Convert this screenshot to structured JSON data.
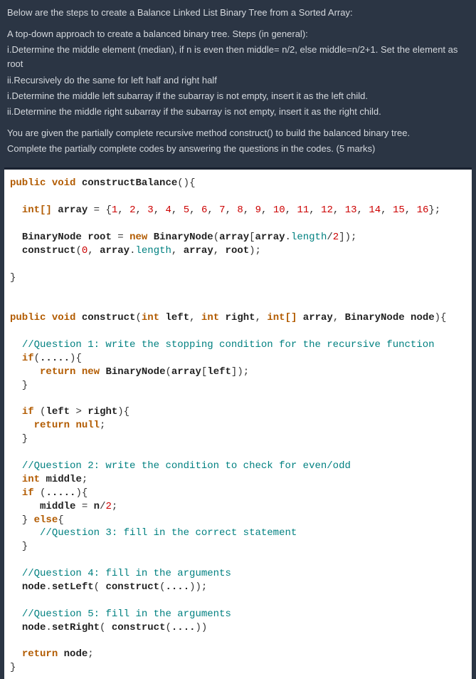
{
  "instructions": {
    "intro": "Below are the steps to create a Balance Linked List Binary Tree from a Sorted Array:",
    "line1": "A top-down approach to create a balanced binary tree. Steps (in general):",
    "line2": "i.Determine the middle element (median), if n is even then middle= n/2, else middle=n/2+1. Set the element as root",
    "line3": "ii.Recursively do the same for left half and right half",
    "line4": "i.Determine the middle left subarray if the subarray is not empty, insert it as the left child.",
    "line5": "ii.Determine the middle right subarray if the subarray is not empty, insert it as the right child.",
    "task1": "You are given the partially complete recursive method construct() to build the balanced binary tree.",
    "task2": "Complete the partially complete codes by answering the questions in the codes. (5 marks)"
  },
  "code": {
    "kw_public": "public",
    "kw_void": "void",
    "kw_int": "int",
    "kw_intarr": "int[]",
    "kw_new": "new",
    "kw_return": "return",
    "kw_if": "if",
    "kw_else": "else",
    "kw_null": "null",
    "fn_constructBalance": "constructBalance",
    "fn_construct": "construct",
    "type_BinaryNode": "BinaryNode",
    "var_array": "array",
    "var_root": "root",
    "var_left": "left",
    "var_right": "right",
    "var_middle": "middle",
    "var_node": "node",
    "var_n": "n",
    "prop_length": "length",
    "m_setLeft": "setLeft",
    "m_setRight": "setRight",
    "nums": {
      "n0": "0",
      "n1": "1",
      "n2": "2",
      "n3": "3",
      "n4": "4",
      "n5": "5",
      "n6": "6",
      "n7": "7",
      "n8": "8",
      "n9": "9",
      "n10": "10",
      "n11": "11",
      "n12": "12",
      "n13": "13",
      "n14": "14",
      "n15": "15",
      "n16": "16"
    },
    "q1": "//Question 1: write the stopping condition for the recursive function",
    "q2": "//Question 2: write the condition to check for even/odd",
    "q3": "//Question 3: fill in the correct statement",
    "q4": "//Question 4: fill in the arguments",
    "q5": "//Question 5: fill in the arguments",
    "dots5": ".....",
    "dots4": "...."
  }
}
